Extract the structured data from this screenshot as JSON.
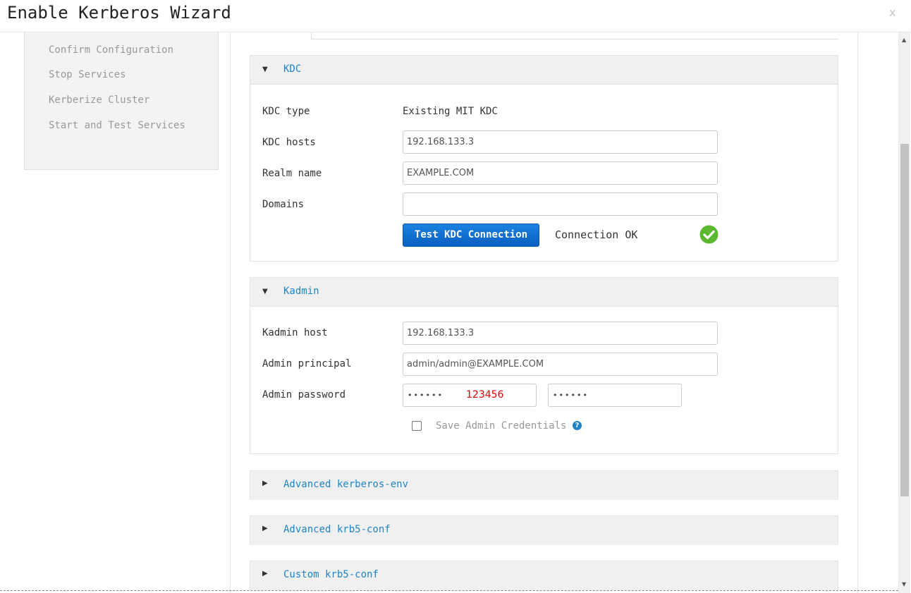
{
  "modal": {
    "title": "Enable Kerberos Wizard",
    "close_label": "x"
  },
  "sidebar": {
    "steps": [
      {
        "label": "Confirm Configuration"
      },
      {
        "label": "Stop Services"
      },
      {
        "label": "Kerberize Cluster"
      },
      {
        "label": "Start and Test Services"
      }
    ]
  },
  "kdc": {
    "title": "KDC",
    "type_label": "KDC type",
    "type_value": "Existing MIT KDC",
    "hosts_label": "KDC hosts",
    "hosts_value": "192.168.133.3",
    "realm_label": "Realm name",
    "realm_value": "EXAMPLE.COM",
    "domains_label": "Domains",
    "domains_value": "",
    "test_button_label": "Test KDC Connection",
    "connection_status": "Connection OK",
    "status_icon": "check-circle-icon",
    "status_color": "#5cb82e"
  },
  "kadmin": {
    "title": "Kadmin",
    "host_label": "Kadmin host",
    "host_value": "192.168.133.3",
    "principal_label": "Admin principal",
    "principal_value": "admin/admin@EXAMPLE.COM",
    "password_label": "Admin password",
    "password_masked": "••••••",
    "password_confirm_masked": "••••••",
    "password_annotation": "123456",
    "save_credentials_label": "Save Admin Credentials",
    "save_credentials_checked": false,
    "help_icon": "question-circle-icon"
  },
  "collapsed_sections": [
    {
      "title": "Advanced kerberos-env"
    },
    {
      "title": "Advanced krb5-conf"
    },
    {
      "title": "Custom krb5-conf"
    }
  ],
  "theme": {
    "link_color": "#1f84c6",
    "primary_button": "#0a6ad0"
  }
}
